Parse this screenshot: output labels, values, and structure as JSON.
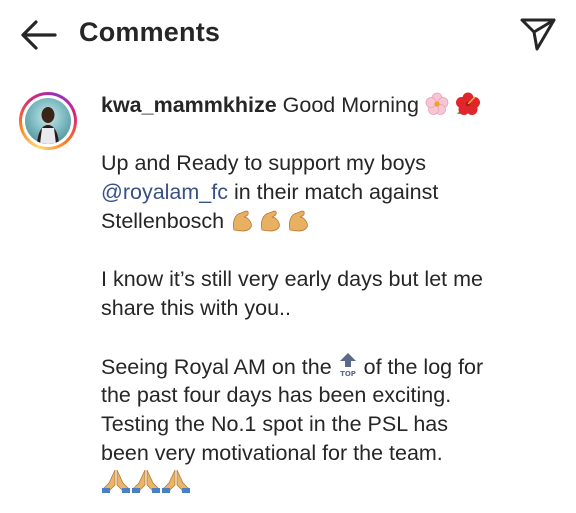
{
  "header": {
    "title": "Comments"
  },
  "comment": {
    "username": "kwa_mammkhize",
    "line1_text": "Good Morning",
    "line2": "Up and Ready to support my boys",
    "mention": "@royalam_fc",
    "line3_after": "in their match against",
    "line4": "Stellenbosch",
    "line5": "I know it’s still very early days but let me",
    "line6": "share this with you..",
    "line7_before": "Seeing Royal AM on the",
    "line7_after": "of the log for",
    "line8": "the past four days has been exciting.",
    "line9": "Testing the No.1 spot in the PSL has",
    "line10": "been very motivational for the team.",
    "top_icon_label": "TOP"
  },
  "colors": {
    "text": "#262626",
    "mention": "#385185",
    "background": "#ffffff"
  },
  "icons": [
    "back-arrow-icon",
    "share-send-icon",
    "cherry-blossom-icon",
    "hibiscus-icon",
    "flexed-biceps-icon",
    "top-arrow-icon",
    "folded-hands-icon"
  ]
}
